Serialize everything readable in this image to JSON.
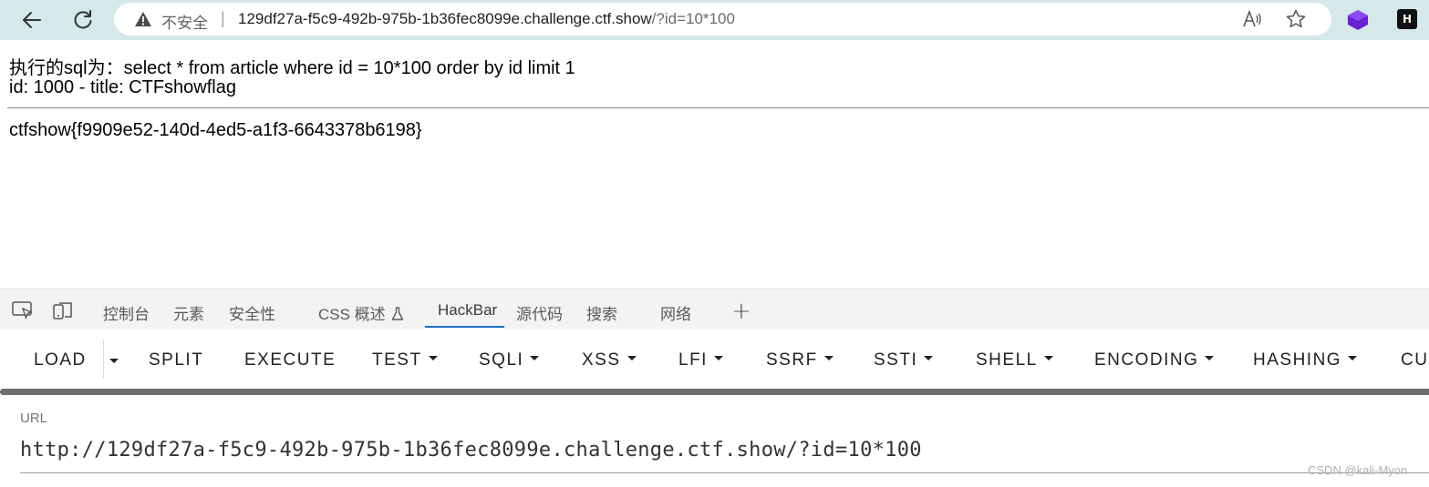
{
  "browser": {
    "security_label": "不安全",
    "separator": "|",
    "url_main": "129df27a-f5c9-492b-975b-1b36fec8099e.challenge.ctf.show",
    "url_query": "/?id=10*100",
    "icons": [
      "back-arrow-icon",
      "reload-icon",
      "warning-icon",
      "read-aloud-icon",
      "star-icon",
      "purple-extension-icon",
      "h-extension-icon"
    ],
    "ext_h_label": "H"
  },
  "page": {
    "sql_line": "执行的sql为：select * from article where id = 10*100 order by id limit 1",
    "result_line": "id: 1000 - title: CTFshowflag",
    "flag_line": "ctfshow{f9909e52-140d-4ed5-a1f3-6643378b6198}"
  },
  "devtools": {
    "tabs": [
      "控制台",
      "元素",
      "安全性",
      "CSS 概述",
      "HackBar",
      "源代码",
      "搜索",
      "网络"
    ],
    "active_tab": "HackBar",
    "add_tab": "+",
    "accent_color": "#1a6fc2"
  },
  "hackbar": {
    "menu": [
      "LOAD",
      "SPLIT",
      "EXECUTE",
      "TEST",
      "SQLI",
      "XSS",
      "LFI",
      "SSRF",
      "SSTI",
      "SHELL",
      "ENCODING",
      "HASHING",
      "CUS"
    ],
    "url_label": "URL",
    "url_value": "http://129df27a-f5c9-492b-975b-1b36fec8099e.challenge.ctf.show/?id=10*100"
  },
  "watermark": "CSDN @kali-Myon"
}
